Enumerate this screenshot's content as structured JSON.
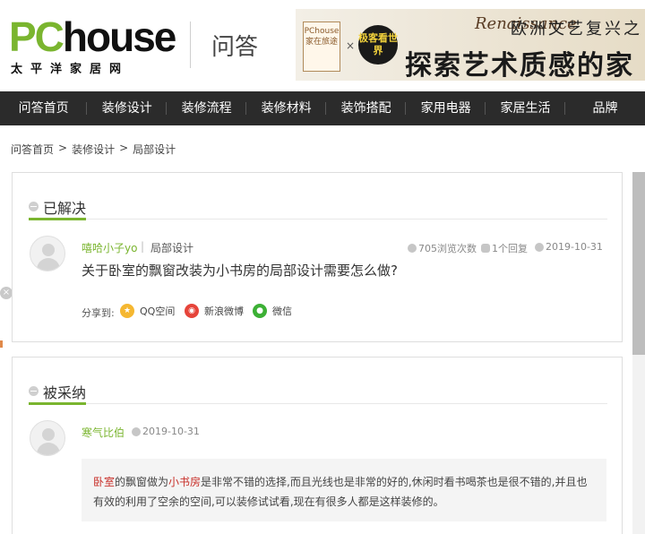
{
  "header": {
    "logo_main": "PChouse",
    "logo_sub": "太平洋家居网",
    "section": "问答"
  },
  "banner": {
    "tag": "PChouse 家在旅途",
    "x": "×",
    "badge": "极客看世界",
    "script": "Renaissance",
    "top_text": "欧洲文艺复兴之",
    "main_text": "探索艺术质感的家"
  },
  "nav": [
    "问答首页",
    "装修设计",
    "装修流程",
    "装修材料",
    "装饰搭配",
    "家用电器",
    "家居生活",
    "品牌"
  ],
  "breadcrumb": [
    "问答首页",
    "装修设计",
    "局部设计"
  ],
  "breadcrumb_sep": ">",
  "question": {
    "status": "已解决",
    "user": "嘻哈小子yo",
    "category": "局部设计",
    "pipe": "|",
    "views": "705浏览次数",
    "replies": "1个回复",
    "date": "2019-10-31",
    "title": "关于卧室的飘窗改装为小书房的局部设计需要怎么做?",
    "share_label": "分享到:",
    "share": [
      "QQ空间",
      "新浪微博",
      "微信"
    ]
  },
  "answer": {
    "status": "被采纳",
    "user": "寒气比伯",
    "date": "2019-10-31",
    "kw1": "卧室",
    "t1": "的飘窗做为",
    "kw2": "小书房",
    "t2": "是非常不错的选择,而且光线也是非常的好的,休闲时看书喝茶也是很不错的,并且也有效的利用了空余的空间,可以装修试试看,现在有很多人都是这样装修的。"
  },
  "colors": {
    "accent": "#7ab52f",
    "nav_bg": "#2b2b2b",
    "keyword": "#c8302a"
  }
}
